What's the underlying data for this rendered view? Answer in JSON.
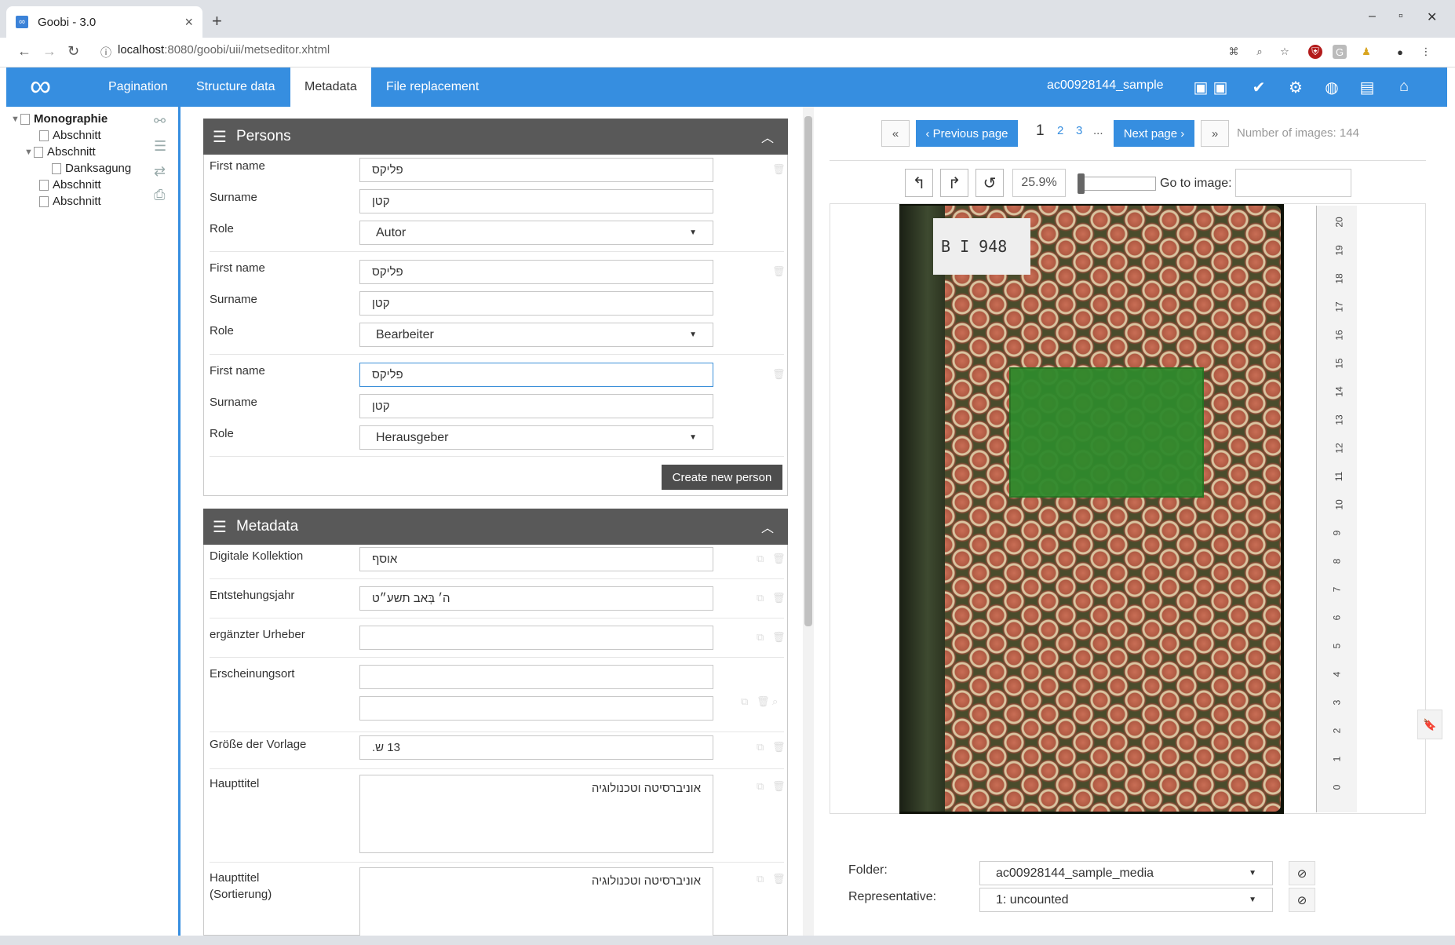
{
  "browser": {
    "tab_title": "Goobi - 3.0",
    "favicon": "∞",
    "url_host": "localhost",
    "url_rest": ":8080/goobi/uii/metseditor.xhtml"
  },
  "header": {
    "logo": "∞",
    "tabs": [
      {
        "label": "Pagination"
      },
      {
        "label": "Structure data"
      },
      {
        "label": "Metadata"
      },
      {
        "label": "File replacement"
      }
    ],
    "active_tab": "Metadata",
    "process_name": "ac00928144_sample",
    "accent_color": "#368ee0"
  },
  "tree": {
    "nodes": [
      {
        "label": "Monographie",
        "level": 0,
        "bold": true
      },
      {
        "label": "Abschnitt",
        "level": 1
      },
      {
        "label": "Abschnitt",
        "level": 1
      },
      {
        "label": "Danksagung",
        "level": 2
      },
      {
        "label": "Abschnitt",
        "level": 1
      },
      {
        "label": "Abschnitt",
        "level": 1
      }
    ]
  },
  "persons": {
    "title": "Persons",
    "labels": {
      "first_name": "First name",
      "surname": "Surname",
      "role": "Role"
    },
    "entries": [
      {
        "first_name": "פליקס",
        "surname": "קטן",
        "role": "Autor"
      },
      {
        "first_name": "פליקס",
        "surname": "קטן",
        "role": "Bearbeiter"
      },
      {
        "first_name": "פליקס",
        "surname": "קטן",
        "role": "Herausgeber"
      }
    ],
    "create_button": "Create new person"
  },
  "metadata": {
    "title": "Metadata",
    "fields": [
      {
        "label": "Digitale Kollektion",
        "value": "אוסף"
      },
      {
        "label": "Entstehungsjahr",
        "value": "ה׳ בְּאב תשע״ט"
      },
      {
        "label": "ergänzter Urheber",
        "value": ""
      },
      {
        "label": "Erscheinungsort",
        "value": "",
        "value2": ""
      },
      {
        "label": "Größe der Vorlage",
        "value": "13 ש."
      },
      {
        "label": "Haupttitel",
        "value": "אוניברסיטה וטכנולוגיה"
      },
      {
        "label": "Haupttitel (Sortierung)",
        "value": "אוניברסיטה וטכנולוגיה"
      }
    ]
  },
  "viewer": {
    "first_label": "«",
    "prev_label": "‹ Previous page",
    "current_page": "1",
    "pages": [
      "2",
      "3",
      "..."
    ],
    "next_label": "Next page ›",
    "last_label": "»",
    "image_count": "Number of images: 144",
    "zoom": "25.9%",
    "goto_label": "Go to image:",
    "goto_value": "",
    "shelfmark": "B I 948",
    "ruler_numbers": [
      "20",
      "19",
      "18",
      "17",
      "16",
      "15",
      "14",
      "13",
      "12",
      "11",
      "10",
      "9",
      "8",
      "7",
      "6",
      "5",
      "4",
      "3",
      "2",
      "1",
      "0"
    ],
    "folder_label": "Folder:",
    "folder_value": "ac00928144_sample_media",
    "representative_label": "Representative:",
    "representative_value": "1: uncounted"
  }
}
